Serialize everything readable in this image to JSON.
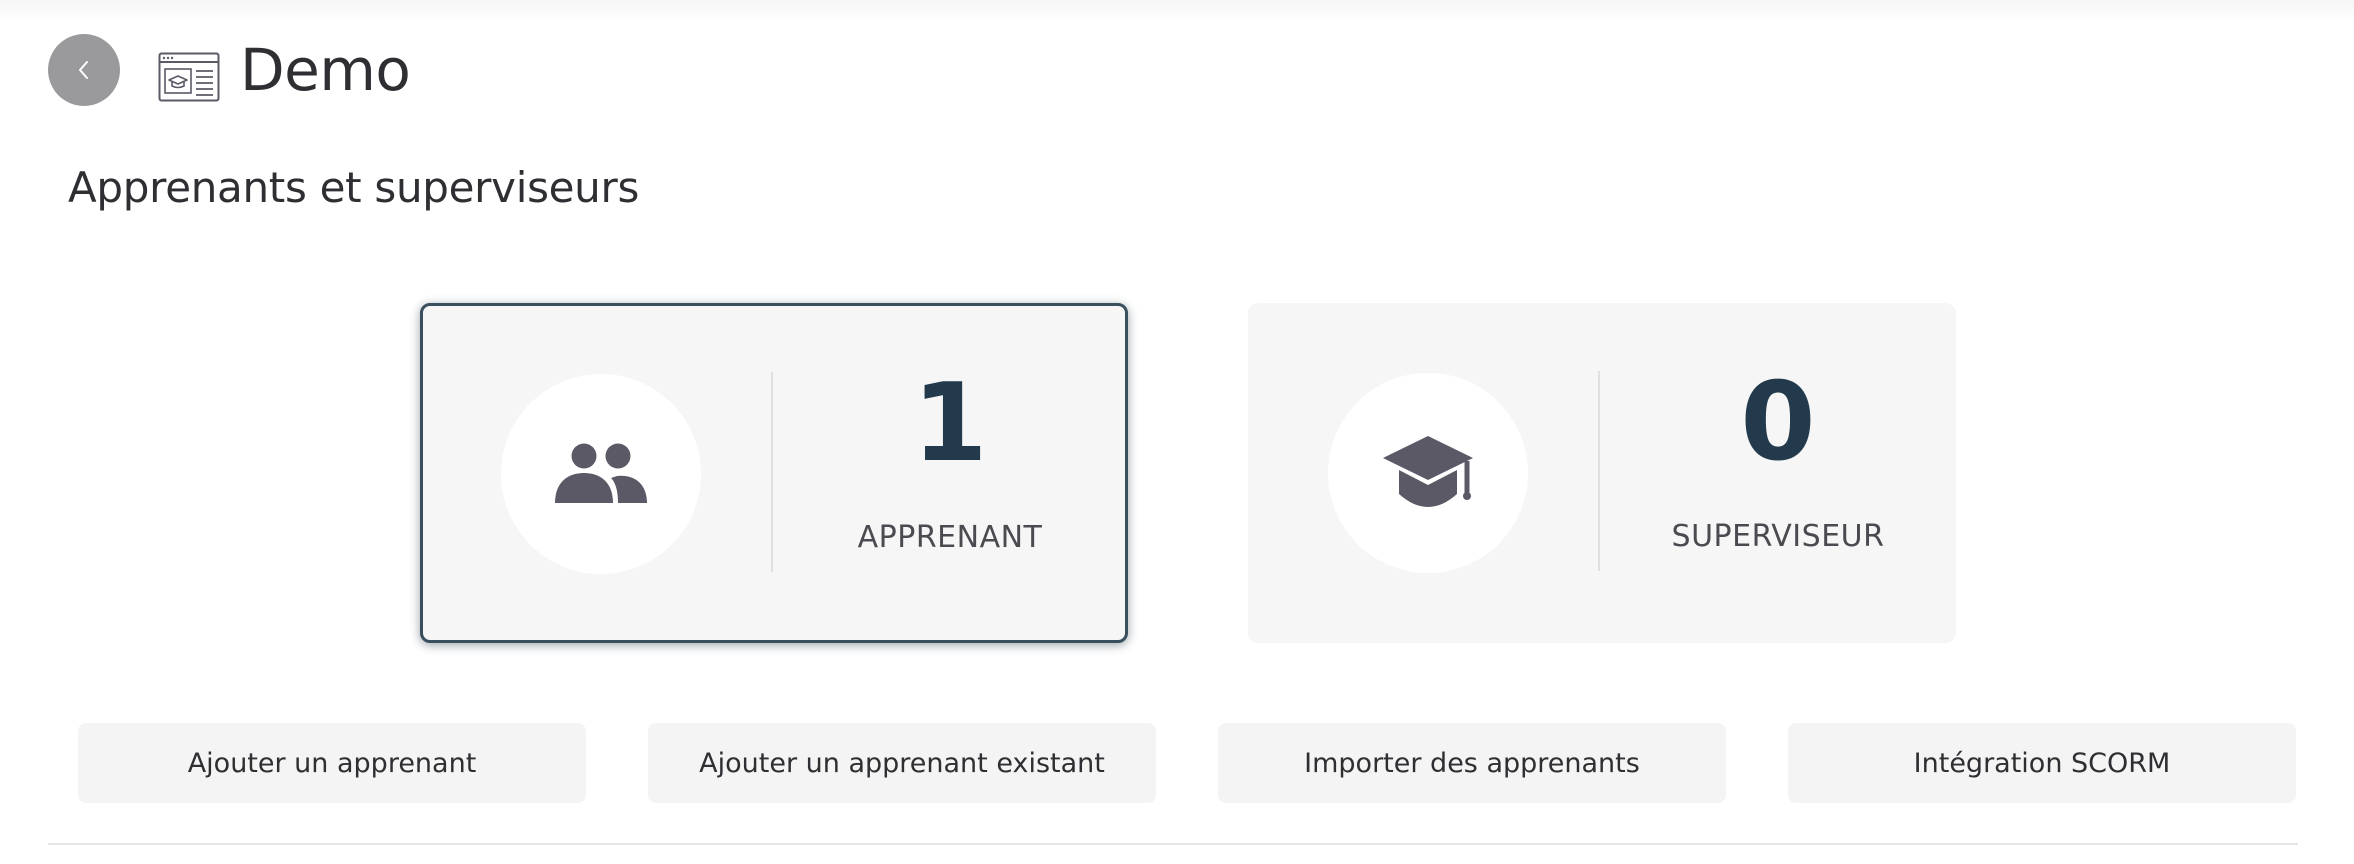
{
  "header": {
    "title": "Demo",
    "back_icon": "chevron-left-icon",
    "course_icon": "course-window-icon"
  },
  "section": {
    "title": "Apprenants et superviseurs"
  },
  "stats": [
    {
      "icon": "users-icon",
      "count": "1",
      "label": "APPRENANT",
      "selected": true
    },
    {
      "icon": "graduation-cap-icon",
      "count": "0",
      "label": "SUPERVISEUR",
      "selected": false
    }
  ],
  "actions": {
    "add_learner": "Ajouter un apprenant",
    "add_existing_learner": "Ajouter un apprenant existant",
    "import_learners": "Importer des apprenants",
    "scorm_integration": "Intégration SCORM"
  },
  "colors": {
    "accent_number": "#223a4b",
    "active_border": "#3a4f5e",
    "card_bg": "#f6f6f6",
    "icon_color": "#5b5966",
    "back_button_bg": "#9a9a9d"
  }
}
